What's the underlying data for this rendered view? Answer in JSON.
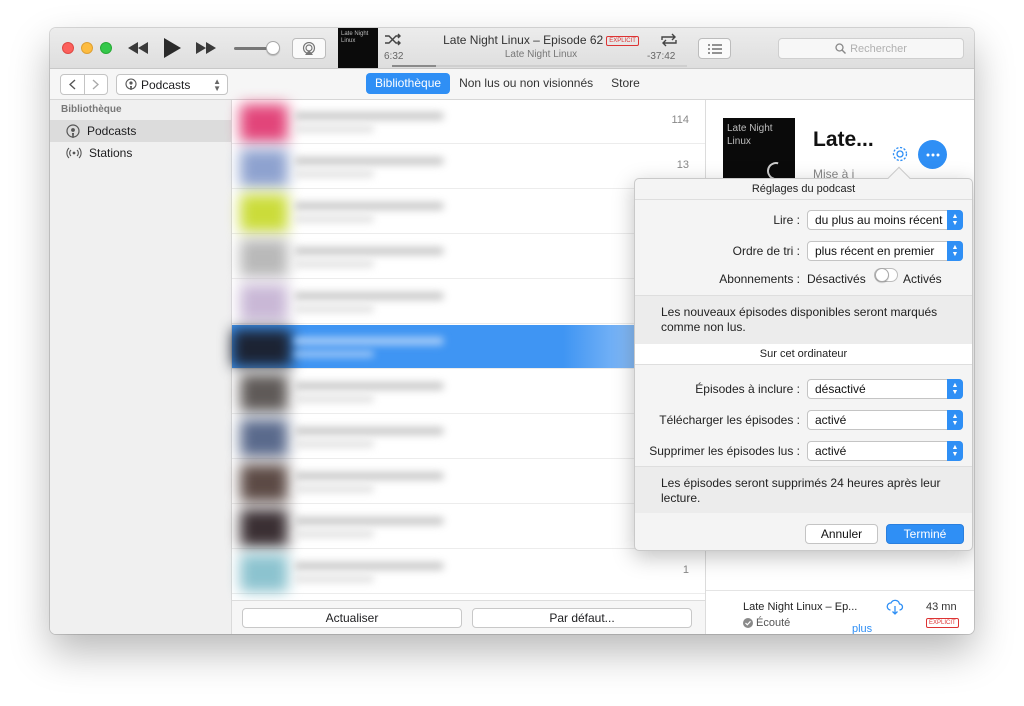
{
  "player": {
    "now_playing_title": "Late Night Linux – Episode 62",
    "explicit_badge": "EXPLICIT",
    "now_playing_subtitle": "Late Night Linux",
    "elapsed": "6:32",
    "remaining": "-37:42",
    "progress_fraction": 0.15,
    "artwork_text": "Late Night Linux",
    "search_placeholder": "Rechercher"
  },
  "toolbar": {
    "media_selector": "Podcasts",
    "tabs": [
      {
        "label": "Bibliothèque",
        "active": true
      },
      {
        "label": "Non lus ou non visionnés",
        "active": false
      },
      {
        "label": "Store",
        "active": false
      }
    ]
  },
  "sidebar": {
    "heading": "Bibliothèque",
    "items": [
      {
        "label": "Podcasts",
        "selected": true,
        "icon": "podcast-icon"
      },
      {
        "label": "Stations",
        "selected": false,
        "icon": "radio-waves-icon"
      }
    ]
  },
  "list": {
    "rows": [
      {
        "count": "114",
        "color": "#e2457a"
      },
      {
        "count": "13",
        "color": "#8ea2cf"
      },
      {
        "count": "",
        "color": "#cbdc3a"
      },
      {
        "count": "",
        "color": "#b9b9b9"
      },
      {
        "count": "",
        "color": "#c9b8d6"
      },
      {
        "count": "",
        "color": "#1c2333"
      },
      {
        "count": "",
        "color": "#5f5a58"
      },
      {
        "count": "",
        "color": "#5a6a8c"
      },
      {
        "count": "",
        "color": "#5c4a45"
      },
      {
        "count": "",
        "color": "#3a2f33"
      },
      {
        "count": "1",
        "color": "#8cc3cf"
      }
    ],
    "selected_index": 5,
    "refresh_button": "Actualiser",
    "default_button": "Par défaut..."
  },
  "detail": {
    "cover_text": "Late Night Linux",
    "title": "Late...",
    "subtitle": "Mise à j",
    "episode": {
      "title": "Late Night Linux – Ep...",
      "status": "Écouté",
      "more_link": "plus",
      "duration": "43 mn",
      "explicit_badge": "EXPLICIT"
    }
  },
  "popover": {
    "section1_title": "Réglages du podcast",
    "play_label": "Lire :",
    "play_value": "du plus au moins récent",
    "sort_label": "Ordre de tri :",
    "sort_value": "plus récent en premier",
    "subscriptions_label": "Abonnements :",
    "subscriptions_off": "Désactivés",
    "subscriptions_on": "Activés",
    "subscriptions_enabled": false,
    "note1": "Les nouveaux épisodes disponibles seront marqués comme non lus.",
    "section2_title": "Sur cet ordinateur",
    "include_label": "Épisodes à inclure :",
    "include_value": "désactivé",
    "download_label": "Télécharger les épisodes :",
    "download_value": "activé",
    "delete_label": "Supprimer les épisodes lus :",
    "delete_value": "activé",
    "note2": "Les épisodes seront supprimés 24 heures après leur lecture.",
    "cancel_button": "Annuler",
    "done_button": "Terminé"
  },
  "colors": {
    "accent": "#2f8ff5",
    "explicit": "#d33333"
  }
}
